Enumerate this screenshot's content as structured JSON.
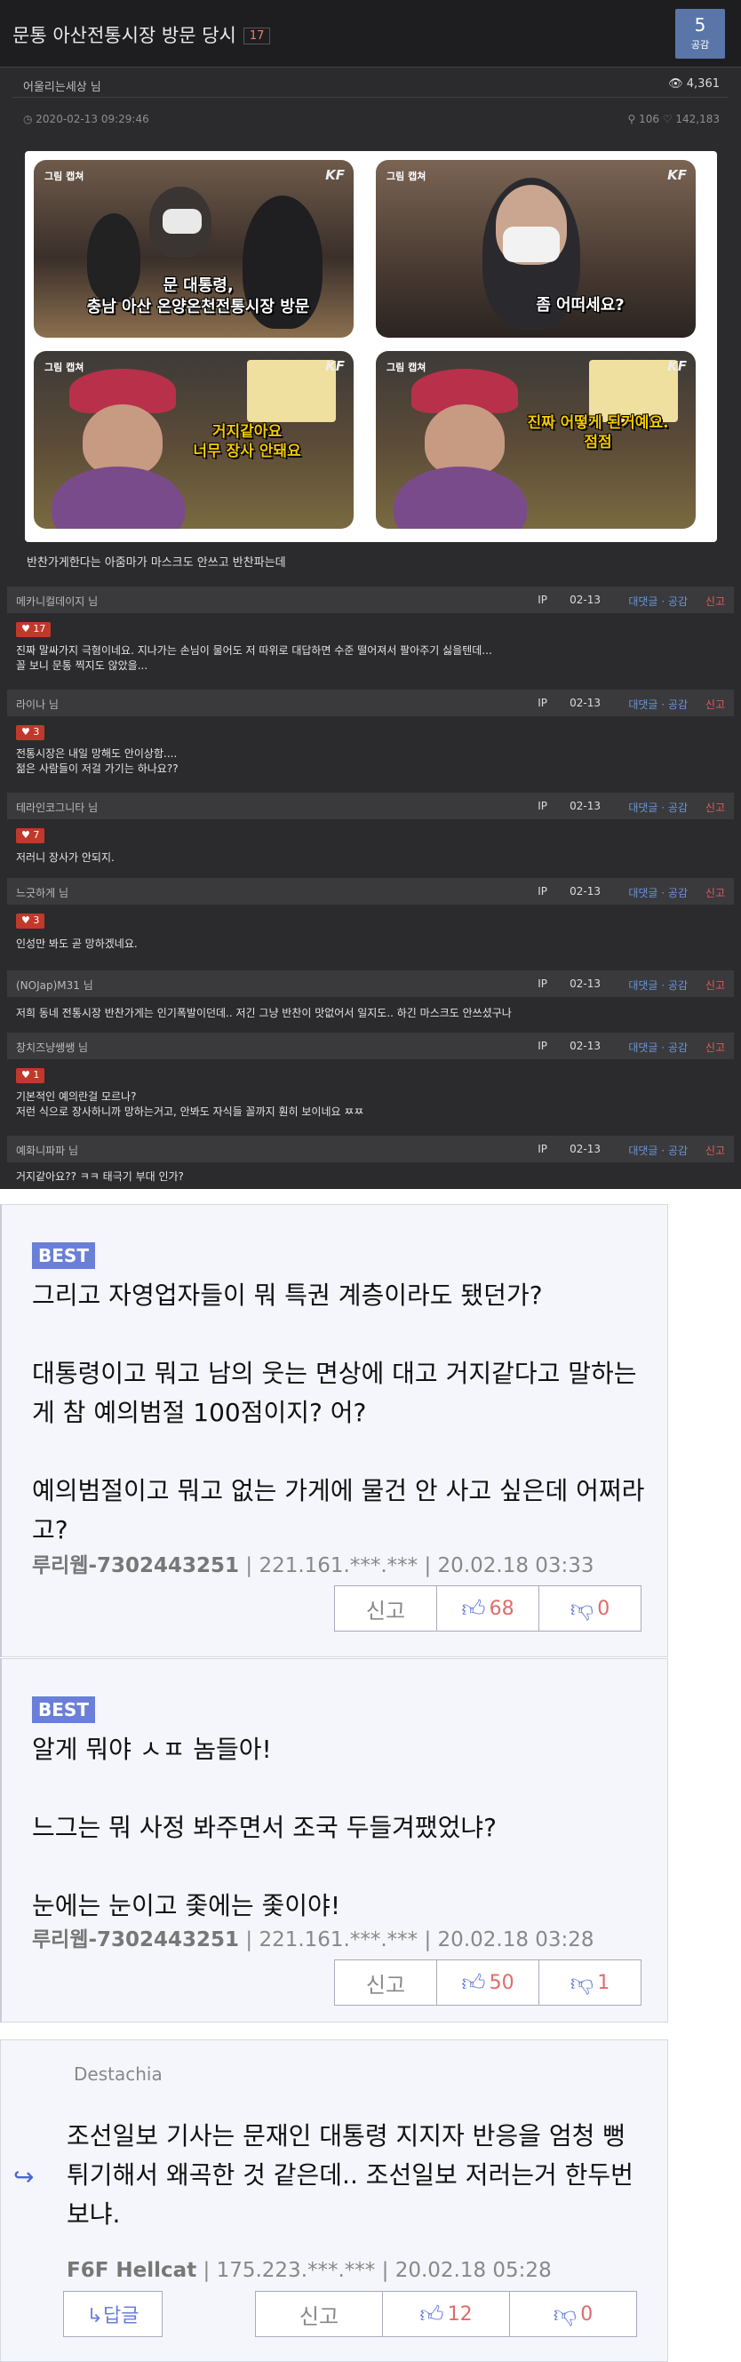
{
  "post": {
    "title": "문통 아산전통시장 방문 당시",
    "title_count": "17",
    "like_count": "5",
    "like_label": "공감",
    "author": "어울리는세상",
    "author_suffix": "님",
    "views": "👁 4,361",
    "date": "◷ 2020-02-13 09:29:46",
    "stats": "⚲ 106 ♡ 142,183",
    "body": "반찬가게한다는 아줌마가 마스크도 안쓰고 반찬파는데"
  },
  "collage": {
    "tag": "그림 캡쳐",
    "brand": "KF",
    "cap1_l1": "문 대통령,",
    "cap1_l2": "충남 아산 온양온천전통시장 방문",
    "cap2": "좀 어떠세요?",
    "cap3_l1": "거지같아요",
    "cap3_l2": "너무 장사 안돼요",
    "cap4_l1": "진짜 어떻게 된거예요.",
    "cap4_l2": "점점"
  },
  "comments": [
    {
      "name": "메카니컬데이지 님",
      "ip": "IP",
      "date": "02-13",
      "actions": "대댓글 · 공감",
      "report": "신고",
      "likes": "♥ 17",
      "text": "진짜 말싸가지 극혐이네요. 지나가는 손님이 물어도 저 따위로 대답하면 수준 떨어져서 팔아주기 싫을텐데...\n꼴 보니 문통 찍지도 않았을..."
    },
    {
      "name": "라이나 님",
      "ip": "IP",
      "date": "02-13",
      "actions": "대댓글 · 공감",
      "report": "신고",
      "likes": "♥ 3",
      "text": "전통시장은 내일 망해도 안이상함....\n젊은 사람들이 저걸 가기는 하나요??"
    },
    {
      "name": "테라인코그니타 님",
      "ip": "IP",
      "date": "02-13",
      "actions": "대댓글 · 공감",
      "report": "신고",
      "likes": "♥ 7",
      "text": "저러니 장사가 안되지."
    },
    {
      "name": "느긋하게 님",
      "ip": "IP",
      "date": "02-13",
      "actions": "대댓글 · 공감",
      "report": "신고",
      "likes": "♥ 3",
      "text": "인성만 봐도 곧 망하겠네요."
    },
    {
      "name": "(NOJap)M31 님",
      "ip": "IP",
      "date": "02-13",
      "actions": "대댓글 · 공감",
      "report": "신고",
      "likes": "",
      "text": "저희 동네 전통시장 반찬가게는 인기폭발이던데.. 저긴 그냥 반찬이 맛없어서 일지도.. 하긴 마스크도 안쓰셨구나"
    },
    {
      "name": "창치즈냥쌩쌩 님",
      "ip": "IP",
      "date": "02-13",
      "actions": "대댓글 · 공감",
      "report": "신고",
      "likes": "♥ 1",
      "text": "기본적인 예의란걸 모르나?\n저런 식으로 장사하니까 망하는거고, 안봐도 자식들 꼴까지 훤히 보이네요 ㅉㅉ"
    },
    {
      "name": "예화니파파 님",
      "ip": "IP",
      "date": "02-13",
      "actions": "대댓글 · 공감",
      "report": "신고",
      "likes": "",
      "text": "거지같아요?? ㅋㅋ 태극기 부대 인가?"
    }
  ],
  "best": [
    {
      "badge": "BEST",
      "text": "그리고 자영업자들이 뭐 특권 계층이라도 됐던가?\n\n대통령이고 뭐고 남의 웃는 면상에 대고 거지같다고 말하는 게 참 예의범절 100점이지? 어?\n\n예의범절이고 뭐고 없는 가게에 물건 안 사고 싶은데 어쩌라고?",
      "nick": "루리웹-7302443251",
      "ip": "221.161.***.***",
      "date": "20.02.18 03:33",
      "report": "신고",
      "up": "68",
      "down": "0"
    },
    {
      "badge": "BEST",
      "text": "알게 뭐야 ㅅㅍ 놈들아!\n\n느그는 뭐 사정 봐주면서 조국 두들겨팼었냐?\n\n눈에는 눈이고 좇에는 좇이야!",
      "nick": "루리웹-7302443251",
      "ip": "221.161.***.***",
      "date": "20.02.18 03:28",
      "report": "신고",
      "up": "50",
      "down": "1"
    }
  ],
  "reply": {
    "parent": "Destachia",
    "text": "조선일보 기사는 문재인 대통령 지지자 반응을 엄청 뻥튀기해서 왜곡한 것 같은데.. 조선일보 저러는거 한두번 보냐.",
    "nick": "F6F Hellcat",
    "ip": "175.223.***.***",
    "date": "20.02.18 05:28",
    "reply_label": "↳답글",
    "report": "신고",
    "up": "12",
    "down": "0"
  },
  "colors": {
    "dark_bg": "#2b2b2d",
    "accent_blue": "#6a7fd8",
    "best_bg": "#f4f6fb",
    "like_red": "#c0392b"
  }
}
